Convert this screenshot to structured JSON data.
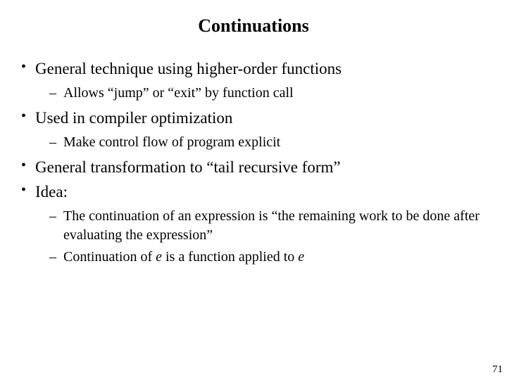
{
  "title": "Continuations",
  "bullets": {
    "b1": "General technique using higher-order functions",
    "b1_sub1": "Allows “jump” or “exit” by function call",
    "b2": "Used in compiler optimization",
    "b2_sub1": "Make control flow of program explicit",
    "b3": "General transformation to “tail recursive form”",
    "b4": "Idea:",
    "b4_sub1": "The continuation of an expression is “the remaining work to be done after evaluating the expression”",
    "b4_sub2_a": "Continuation of ",
    "b4_sub2_e1": "e",
    "b4_sub2_b": "  is a function applied to ",
    "b4_sub2_e2": "e"
  },
  "page_number": "71"
}
